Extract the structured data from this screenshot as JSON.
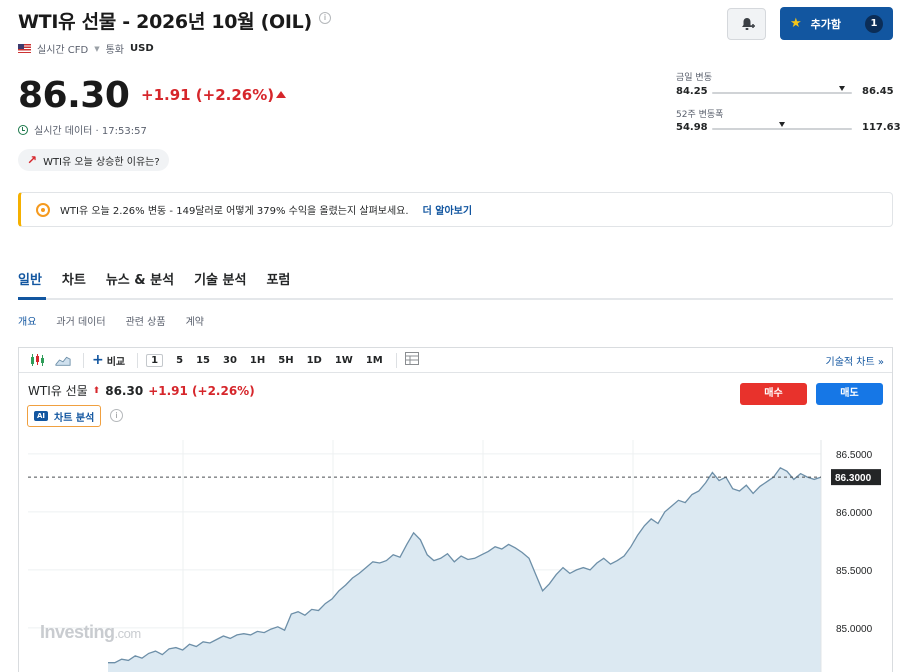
{
  "header": {
    "title": "WTI유 선물 - 2026년 10월 (OIL)",
    "market_type": "실시간 CFD",
    "currency_label": "통화",
    "currency": "USD",
    "info_icon": "info-icon"
  },
  "actions": {
    "alert_icon": "bell-plus-icon",
    "watchlist_label": "추가함",
    "watchlist_count": "1"
  },
  "quote": {
    "price": "86.30",
    "change": "+1.91 (+2.26%)",
    "realtime_text": "실시간 데이터 · 17:53:57",
    "why_text": "WTI유 오늘 상승한 이유는?"
  },
  "ranges": {
    "day_label": "금일 변동",
    "day_low": "84.25",
    "day_high": "86.45",
    "day_position": 0.93,
    "week52_label": "52주 변동폭",
    "week52_low": "54.98",
    "week52_high": "117.63",
    "week52_position": 0.5
  },
  "banner": {
    "text": "WTI유 오늘 2.26% 변동 - 149달러로 어떻게 379% 수익을 올렸는지 살펴보세요.",
    "link": "더 알아보기"
  },
  "tabs": [
    "일반",
    "차트",
    "뉴스 & 분석",
    "기술 분석",
    "포럼"
  ],
  "subtabs": [
    "개요",
    "과거 데이터",
    "관련 상품",
    "계약"
  ],
  "chart_toolbar": {
    "compare": "비교",
    "intervals": [
      "1",
      "5",
      "15",
      "30",
      "1H",
      "5H",
      "1D",
      "1W",
      "1M"
    ],
    "selected_interval": "1",
    "tech_chart_link": "기술적 차트 »"
  },
  "chart_header": {
    "symbol": "WTI유 선물",
    "price": "86.30",
    "change": "+1.91 (+2.26%)",
    "ai_badge": "AI",
    "ai_label": "차트 분석",
    "buy": "매수",
    "sell": "매도"
  },
  "watermark": {
    "brand": "Investing",
    "suffix": ".com"
  },
  "colors": {
    "accent": "#1256a0",
    "up": "#d6262b",
    "line": "#6d8fa8",
    "area": "#dce9f2"
  },
  "chart_data": {
    "type": "area",
    "current_price": 86.3,
    "current_label": "86.3000",
    "yticks": [
      86.5,
      86.0,
      85.5,
      85.0
    ],
    "ytick_labels": [
      "86.5000",
      "86.0000",
      "85.5000",
      "85.0000"
    ],
    "ylim": [
      84.62,
      86.62
    ],
    "grid": true,
    "values": [
      84.7,
      84.7,
      84.73,
      84.72,
      84.76,
      84.74,
      84.78,
      84.8,
      84.77,
      84.82,
      84.83,
      84.81,
      84.86,
      84.84,
      84.88,
      84.87,
      84.9,
      84.93,
      84.91,
      84.94,
      84.95,
      84.94,
      84.97,
      84.96,
      84.99,
      85.01,
      84.98,
      85.12,
      85.14,
      85.11,
      85.16,
      85.15,
      85.21,
      85.25,
      85.32,
      85.37,
      85.43,
      85.47,
      85.52,
      85.57,
      85.56,
      85.58,
      85.63,
      85.61,
      85.72,
      85.82,
      85.76,
      85.63,
      85.58,
      85.6,
      85.64,
      85.57,
      85.62,
      85.59,
      85.6,
      85.63,
      85.66,
      85.7,
      85.68,
      85.72,
      85.69,
      85.65,
      85.6,
      85.46,
      85.32,
      85.38,
      85.46,
      85.52,
      85.47,
      85.5,
      85.52,
      85.5,
      85.56,
      85.6,
      85.55,
      85.58,
      85.62,
      85.7,
      85.8,
      85.88,
      85.94,
      85.9,
      86.0,
      86.05,
      86.1,
      86.08,
      86.15,
      86.18,
      86.25,
      86.34,
      86.27,
      86.3,
      86.2,
      86.18,
      86.23,
      86.16,
      86.22,
      86.26,
      86.3,
      86.38,
      86.35,
      86.28,
      86.33,
      86.3,
      86.28,
      86.3
    ]
  }
}
